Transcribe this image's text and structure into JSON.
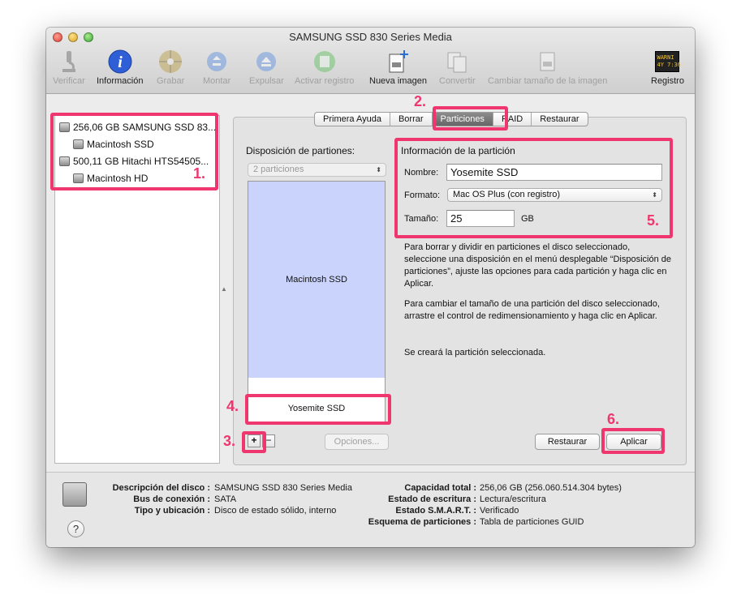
{
  "window": {
    "title": "SAMSUNG SSD 830 Series Media"
  },
  "toolbar": [
    {
      "label": "Verificar",
      "icon": "microscope-icon",
      "enabled": false
    },
    {
      "label": "Información",
      "icon": "info-icon",
      "enabled": true
    },
    {
      "label": "Grabar",
      "icon": "burn-icon",
      "enabled": false
    },
    {
      "label": "Montar",
      "icon": "mount-icon",
      "enabled": false
    },
    {
      "label": "Expulsar",
      "icon": "eject-icon",
      "enabled": false
    },
    {
      "label": "Activar registro",
      "icon": "journal-icon",
      "enabled": false
    },
    {
      "label": "Nueva imagen",
      "icon": "new-image-icon",
      "enabled": true
    },
    {
      "label": "Convertir",
      "icon": "convert-icon",
      "enabled": false
    },
    {
      "label": "Cambiar tamaño de la imagen",
      "icon": "resize-image-icon",
      "enabled": false
    },
    {
      "label": "Registro",
      "icon": "log-icon",
      "enabled": true,
      "log_text": "WARNI\n4Y 7:36"
    }
  ],
  "disks": [
    {
      "label": "256,06 GB SAMSUNG SSD 83..."
    },
    {
      "label": "Macintosh SSD"
    },
    {
      "label": "500,11 GB Hitachi HTS54505..."
    },
    {
      "label": "Macintosh HD"
    }
  ],
  "tabs": [
    "Primera Ayuda",
    "Borrar",
    "Particiones",
    "RAID",
    "Restaurar"
  ],
  "active_tab": "Particiones",
  "layout_section": {
    "title": "Disposición de partiones:",
    "popup_value": "2 particiones",
    "partitions": [
      "Macintosh SSD",
      "Yosemite SSD"
    ],
    "options_button": "Opciones...",
    "add_button": "+",
    "remove_button": "−"
  },
  "partition_info": {
    "title": "Información de la partición",
    "name_label": "Nombre:",
    "name_value": "Yosemite SSD",
    "format_label": "Formato:",
    "format_value": "Mac OS Plus (con registro)",
    "size_label": "Tamaño:",
    "size_value": "25",
    "size_unit": "GB"
  },
  "help_text": {
    "p1": "Para borrar y dividir en particiones el disco seleccionado, seleccione una disposición en el menú desplegable “Disposición de particiones”, ajuste las opciones para cada partición y haga clic en Aplicar.",
    "p2": "Para cambiar el tamaño de una partición del disco seleccionado, arrastre el control de redimensionamiento y haga clic en Aplicar.",
    "p3": "Se creará la partición seleccionada."
  },
  "buttons": {
    "restore": "Restaurar",
    "apply": "Aplicar"
  },
  "annotations": [
    "1.",
    "2.",
    "3.",
    "4.",
    "5.",
    "6."
  ],
  "annotation_color": "#f0366e",
  "bottom_info": {
    "left": [
      {
        "label": "Descripción del disco :",
        "value": "SAMSUNG SSD 830 Series Media"
      },
      {
        "label": "Bus de conexión :",
        "value": "SATA"
      },
      {
        "label": "Tipo y ubicación :",
        "value": "Disco de estado sólido, interno"
      }
    ],
    "right": [
      {
        "label": "Capacidad total :",
        "value": "256,06 GB (256.060.514.304 bytes)"
      },
      {
        "label": "Estado de escritura :",
        "value": "Lectura/escritura"
      },
      {
        "label": "Estado S.M.A.R.T. :",
        "value": "Verificado"
      },
      {
        "label": "Esquema de particiones :",
        "value": "Tabla de particiones GUID"
      }
    ],
    "help_button": "?"
  }
}
